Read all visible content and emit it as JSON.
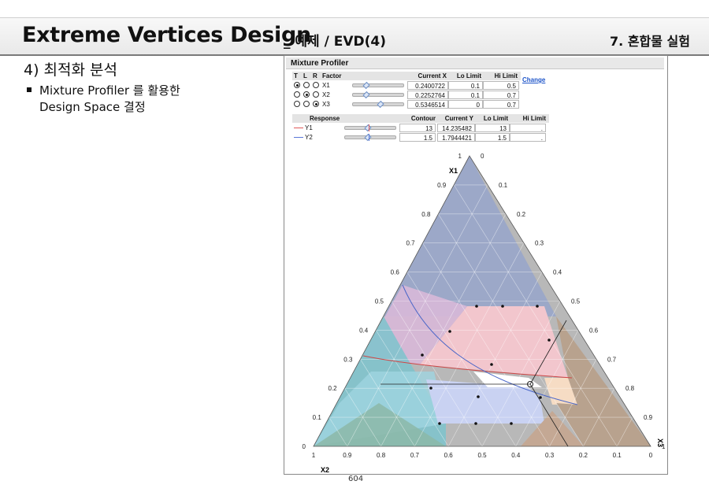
{
  "header": {
    "title_main": "Extreme Vertices Design",
    "title_sub": "_ 예제 / EVD(4)",
    "chapter": "7. 혼합물 실험"
  },
  "section": {
    "title": "4) 최적화 분석",
    "bullet_line1": "Mixture Profiler 를 활용한",
    "bullet_line2": "Design Space 결정"
  },
  "profiler": {
    "title": "Mixture Profiler",
    "factor_headers": [
      "T",
      "L",
      "R",
      "Factor",
      "Current X",
      "Lo Limit",
      "Hi Limit"
    ],
    "factors": [
      {
        "name": "X1",
        "current": "0.2400722",
        "lo": "0.1",
        "hi": "0.5",
        "selected": 0,
        "slider": 0.24
      },
      {
        "name": "X2",
        "current": "0.2252764",
        "lo": "0.1",
        "hi": "0.7",
        "selected": 1,
        "slider": 0.225
      },
      {
        "name": "X3",
        "current": "0.5346514",
        "lo": "0",
        "hi": "0.7",
        "selected": 2,
        "slider": 0.535
      }
    ],
    "change_label": "Change",
    "response_headers": [
      "Response",
      "Contour",
      "Current Y",
      "Lo Limit",
      "Hi Limit"
    ],
    "responses": [
      {
        "name": "Y1",
        "color": "#e05a5a",
        "contour": "13",
        "current": "14.235482",
        "lo": "13",
        "hi": "."
      },
      {
        "name": "Y2",
        "color": "#5a78d8",
        "contour": "1.5",
        "current": "1.7944421",
        "lo": "1.5",
        "hi": "."
      }
    ]
  },
  "ternary": {
    "vertex_top": "X1",
    "vertex_left": "X2",
    "vertex_right": "X3",
    "left_ticks": [
      "0",
      "0.1",
      "0.2",
      "0.3",
      "0.4",
      "0.5",
      "0.6",
      "0.7",
      "0.8",
      "0.9",
      "1"
    ],
    "right_ticks": [
      "0",
      "0.1",
      "0.2",
      "0.3",
      "0.4",
      "0.5",
      "0.6",
      "0.7",
      "0.8",
      "0.9",
      "1"
    ],
    "bottom_ticks": [
      "1",
      "0.9",
      "0.8",
      "0.7",
      "0.6",
      "0.5",
      "0.4",
      "0.3",
      "0.2",
      "0.1",
      "0"
    ]
  },
  "page_number": "604"
}
